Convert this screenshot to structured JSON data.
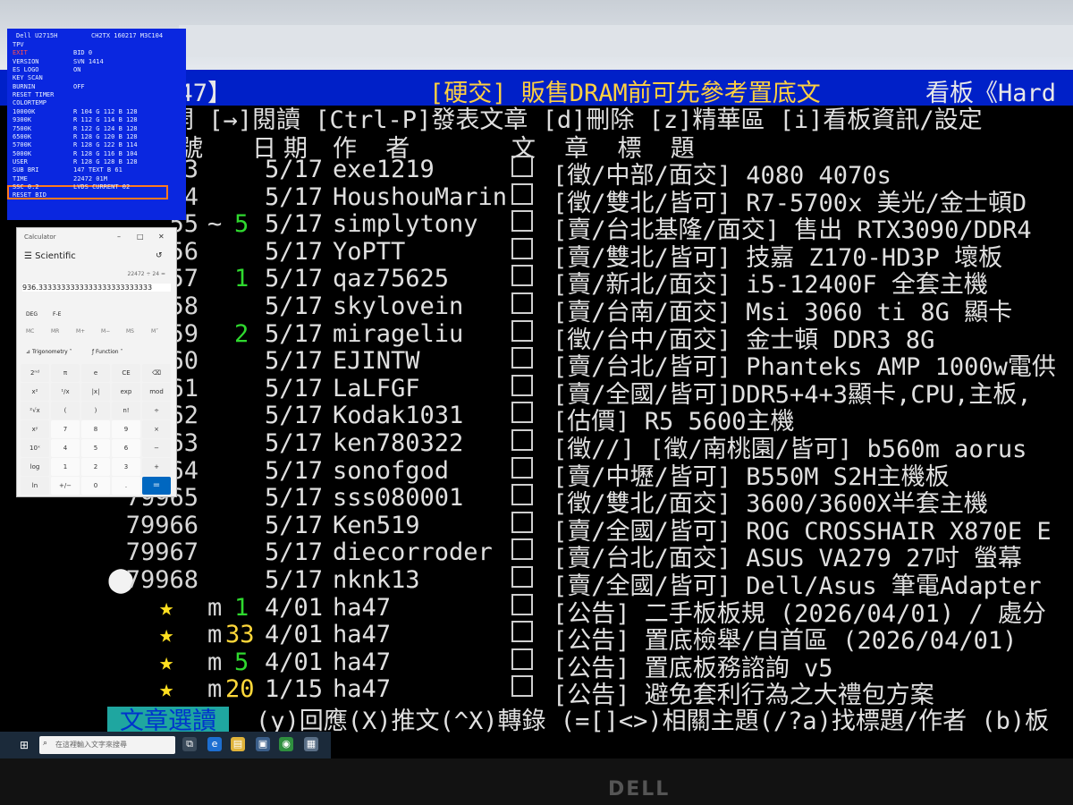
{
  "board_title": {
    "owner": "ha47",
    "topic": "[硬交] 販售DRAM前可先參考置底文",
    "board": "看板《Hard"
  },
  "command_line": "開 [→]閱讀 [Ctrl-P]發表文章 [d]刪除 [z]精華區 [i]看板資訊/設定",
  "header": {
    "col_num": "號",
    "col_date": "日期",
    "col_author": "作 者",
    "col_subject": "文 章 標 題"
  },
  "articles": [
    {
      "num": "3",
      "mark": "",
      "push": "",
      "date": "5/17",
      "author": "exe1219",
      "subject": "[徵/中部/面交] 4080 4070s"
    },
    {
      "num": "4",
      "mark": "",
      "push": "",
      "date": "5/17",
      "author": "HoushouMarin",
      "subject": "[徵/雙北/皆可] R7-5700x 美光/金士頓D"
    },
    {
      "num": "55",
      "mark": "~",
      "push": "5",
      "date": "5/17",
      "author": "simplytony",
      "subject": "[賣/台北基隆/面交] 售出 RTX3090/DDR4"
    },
    {
      "num": "56",
      "mark": "",
      "push": "",
      "date": "5/17",
      "author": "YoPTT",
      "subject": "[賣/雙北/皆可] 技嘉 Z170-HD3P 壞板"
    },
    {
      "num": "57",
      "mark": "",
      "push": "1",
      "date": "5/17",
      "author": "qaz75625",
      "subject": "[賣/新北/面交] i5-12400F 全套主機"
    },
    {
      "num": "58",
      "mark": "",
      "push": "",
      "date": "5/17",
      "author": "skylovein",
      "subject": "[賣/台南/面交] Msi 3060 ti 8G 顯卡"
    },
    {
      "num": "59",
      "mark": "",
      "push": "2",
      "date": "5/17",
      "author": "mirageliu",
      "subject": "[徵/台中/面交] 金士頓 DDR3 8G"
    },
    {
      "num": "60",
      "mark": "",
      "push": "",
      "date": "5/17",
      "author": "EJINTW",
      "subject": "[賣/台北/皆可] Phanteks AMP 1000w電供"
    },
    {
      "num": "61",
      "mark": "",
      "push": "",
      "date": "5/17",
      "author": "LaLFGF",
      "subject": "[賣/全國/皆可]DDR5+4+3顯卡,CPU,主板,"
    },
    {
      "num": "62",
      "mark": "",
      "push": "",
      "date": "5/17",
      "author": "Kodak1031",
      "subject": "[估價] R5 5600主機"
    },
    {
      "num": "63",
      "mark": "",
      "push": "",
      "date": "5/17",
      "author": "ken780322",
      "subject": "[徵//] [徵/南桃園/皆可] b560m aorus"
    },
    {
      "num": "64",
      "mark": "",
      "push": "",
      "date": "5/17",
      "author": "sonofgod",
      "subject": "[賣/中壢/皆可] B550M S2H主機板"
    },
    {
      "num": "79965",
      "mark": "",
      "push": "",
      "date": "5/17",
      "author": "sss080001",
      "subject": "[徵/雙北/面交] 3600/3600X半套主機"
    },
    {
      "num": "79966",
      "mark": "",
      "push": "",
      "date": "5/17",
      "author": "Ken519",
      "subject": "[賣/全國/皆可] ROG CROSSHAIR X870E E"
    },
    {
      "num": "79967",
      "mark": "",
      "push": "",
      "date": "5/17",
      "author": "diecorroder",
      "subject": "[賣/台北/面交] ASUS VA279 27吋 螢幕"
    },
    {
      "num": "79968",
      "mark": "",
      "push": "",
      "date": "5/17",
      "author": "nknk13",
      "subject": "[賣/全國/皆可] Dell/Asus 筆電Adapter",
      "cursor": "⬤"
    },
    {
      "num": "★",
      "mark": "m",
      "push": "1",
      "date": "4/01",
      "author": "ha47",
      "subject": "[公告] 二手板板規 (2026/04/01) / 處分"
    },
    {
      "num": "★",
      "mark": "m",
      "push": "33",
      "date": "4/01",
      "author": "ha47",
      "subject": "[公告] 置底檢舉/自首區 (2026/04/01)"
    },
    {
      "num": "★",
      "mark": "m",
      "push": "5",
      "date": "4/01",
      "author": "ha47",
      "subject": "[公告] 置底板務諮詢 v5"
    },
    {
      "num": "★",
      "mark": "m",
      "push": "20",
      "date": "1/15",
      "author": "ha47",
      "subject": "[公告] 避免套利行為之大禮包方案"
    }
  ],
  "footer": {
    "mode_label": "文章選讀",
    "tips": "(y)回應(X)推文(^X)轉錄 (=[]<>)相關主題(/?a)找標題/作者 (b)板"
  },
  "osd": {
    "model": "Dell U2715H",
    "codes": "CH2TX   160217   M3C104",
    "items": [
      {
        "k": "TPV",
        "v": ""
      },
      {
        "k": "EXIT",
        "v": "BID        0",
        "red": true
      },
      {
        "k": "VERSION",
        "v": "SVN     1414"
      },
      {
        "k": "ES LOGO",
        "v": "ON"
      },
      {
        "k": "KEY SCAN",
        "v": ""
      },
      {
        "k": "BURNIN",
        "v": "OFF"
      },
      {
        "k": "RESET TIMER",
        "v": ""
      },
      {
        "k": "COLORTEMP",
        "v": ""
      },
      {
        "k": "10000K",
        "v": "R 104 G 112 B 128"
      },
      {
        "k": "9300K",
        "v": "R 112 G 114 B 128"
      },
      {
        "k": "7500K",
        "v": "R 122 G 124 B 128"
      },
      {
        "k": "6500K",
        "v": "R 128 G 120 B 128"
      },
      {
        "k": "5700K",
        "v": "R 128 G 122 B 114"
      },
      {
        "k": "5000K",
        "v": "R 128 G 116 B 104"
      },
      {
        "k": "USER",
        "v": "R 128 G 128 B 128"
      },
      {
        "k": "SUB BRI",
        "v": "147  TEXT  B    61"
      },
      {
        "k": "TIME",
        "v": "22472    01M"
      },
      {
        "k": "SSC  0.2",
        "v": "LVDS CURRENT   02"
      },
      {
        "k": "RESET BID",
        "v": ""
      }
    ]
  },
  "calculator": {
    "app": "Calculator",
    "mode": "Scientific",
    "expression": "22472 ÷ 24 =",
    "display": "936.3333333333333333333333333",
    "angle": "DEG",
    "fe": "F-E",
    "mem": [
      "MC",
      "MR",
      "M+",
      "M−",
      "MS",
      "M˅"
    ],
    "trig": "Trigonometry",
    "func": "Function",
    "keys": [
      [
        "2ⁿᵈ",
        "π",
        "e",
        "CE",
        "⌫"
      ],
      [
        "x²",
        "¹/x",
        "|x|",
        "exp",
        "mod"
      ],
      [
        "²√x",
        "(",
        ")",
        "n!",
        "÷"
      ],
      [
        "xʸ",
        "7",
        "8",
        "9",
        "×"
      ],
      [
        "10ˣ",
        "4",
        "5",
        "6",
        "−"
      ],
      [
        "log",
        "1",
        "2",
        "3",
        "+"
      ],
      [
        "ln",
        "+/−",
        "0",
        ".",
        "="
      ]
    ]
  },
  "taskbar": {
    "search_placeholder": "在這裡輸入文字來搜尋"
  },
  "monitor_brand": "DELL"
}
